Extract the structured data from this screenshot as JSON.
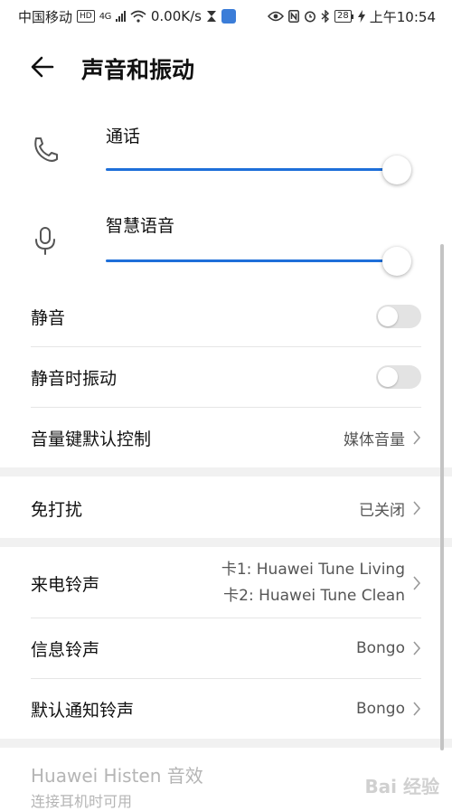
{
  "status_bar": {
    "carrier": "中国移动",
    "hd_badge": "HD",
    "network_type": "4G",
    "speed": "0.00K/s",
    "battery": "28",
    "time": "上午10:54"
  },
  "header": {
    "title": "声音和振动",
    "back_icon": "arrow-left-icon"
  },
  "volume": {
    "call": {
      "label": "通话",
      "icon": "phone-icon",
      "level": 1.0
    },
    "assistant": {
      "label": "智慧语音",
      "icon": "microphone-icon",
      "level": 1.0
    }
  },
  "settings": {
    "mute": {
      "label": "静音",
      "on": false
    },
    "vibrate_on_mute": {
      "label": "静音时振动",
      "on": false
    },
    "volume_key": {
      "label": "音量键默认控制",
      "value": "媒体音量"
    },
    "dnd": {
      "label": "免打扰",
      "value": "已关闭"
    },
    "ringtone": {
      "label": "来电铃声",
      "card1": "卡1: Huawei Tune Living",
      "card2": "卡2: Huawei Tune Clean"
    },
    "message_tone": {
      "label": "信息铃声",
      "value": "Bongo"
    },
    "notification_tone": {
      "label": "默认通知铃声",
      "value": "Bongo"
    },
    "histen": {
      "label": "Huawei Histen 音效",
      "sub": "连接耳机时可用"
    }
  },
  "watermark": "Bai 经验",
  "colors": {
    "accent": "#1e6fd9",
    "toggle_off": "#e3e3e3",
    "section_bg": "#f1f1f1",
    "disabled_text": "#b5b5b5"
  }
}
